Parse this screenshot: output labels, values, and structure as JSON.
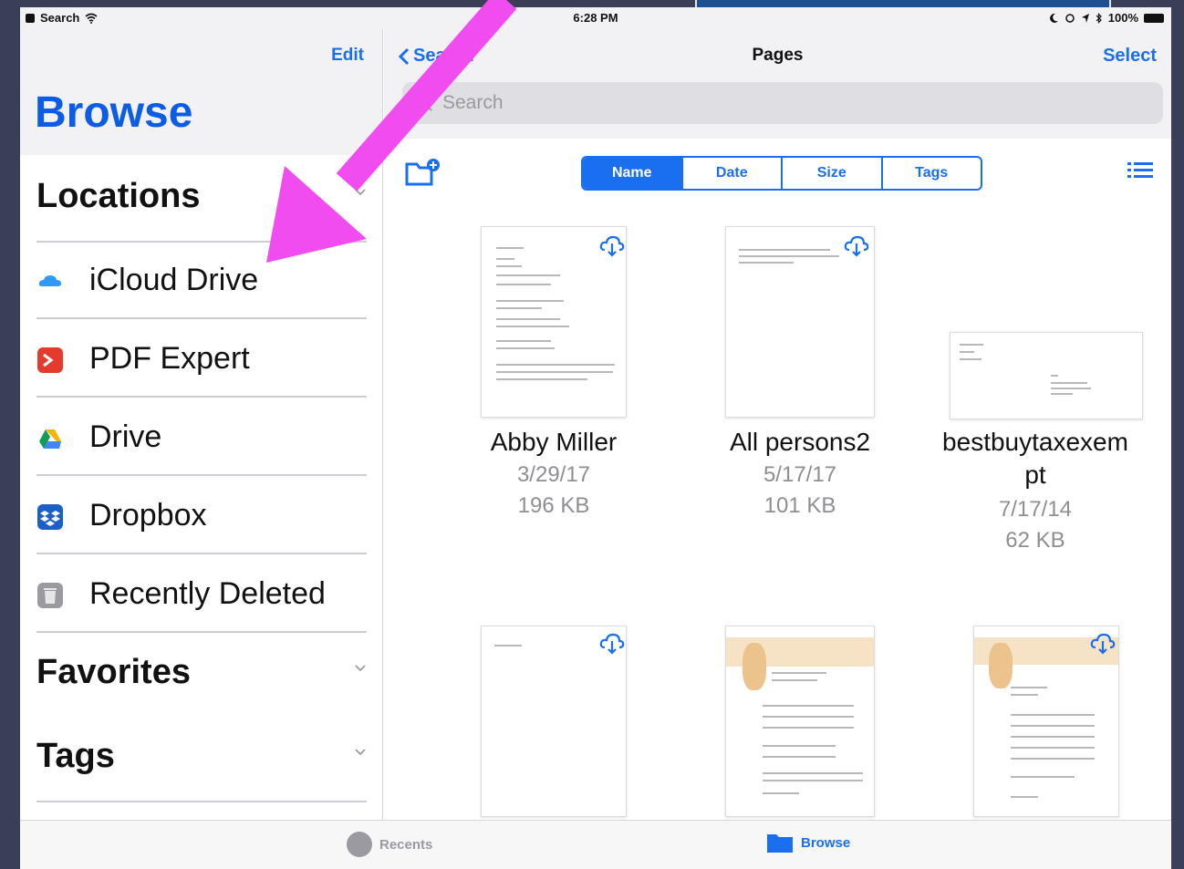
{
  "status_bar": {
    "left_app": "Search",
    "time": "6:28 PM",
    "battery": "100%"
  },
  "sidebar": {
    "edit_label": "Edit",
    "title": "Browse",
    "locations_header": "Locations",
    "locations": [
      {
        "label": "iCloud Drive",
        "icon": "icloud-icon"
      },
      {
        "label": "PDF Expert",
        "icon": "pdf-expert-icon"
      },
      {
        "label": "Drive",
        "icon": "google-drive-icon"
      },
      {
        "label": "Dropbox",
        "icon": "dropbox-icon"
      },
      {
        "label": "Recently Deleted",
        "icon": "trash-icon"
      }
    ],
    "favorites_header": "Favorites",
    "tags_header": "Tags"
  },
  "main": {
    "back_label": "Search",
    "title": "Pages",
    "select_label": "Select",
    "search_placeholder": "Search",
    "sort_options": [
      "Name",
      "Date",
      "Size",
      "Tags"
    ],
    "active_sort": "Name",
    "files": [
      {
        "name": "Abby Miller",
        "date": "3/29/17",
        "size": "196 KB",
        "in_cloud": true
      },
      {
        "name": "All persons2",
        "date": "5/17/17",
        "size": "101 KB",
        "in_cloud": true
      },
      {
        "name": "bestbuytaxexem",
        "name_line2": "pt",
        "date": "7/17/14",
        "size": "62 KB",
        "in_cloud": false
      },
      {
        "in_cloud": true
      },
      {
        "in_cloud": false
      },
      {
        "in_cloud": true
      }
    ]
  },
  "tab_bar": {
    "recents_label": "Recents",
    "browse_label": "Browse"
  },
  "colors": {
    "accent": "#1a6ff0",
    "title_blue": "#0d5ce6",
    "annotation_arrow": "#f04cf0"
  }
}
